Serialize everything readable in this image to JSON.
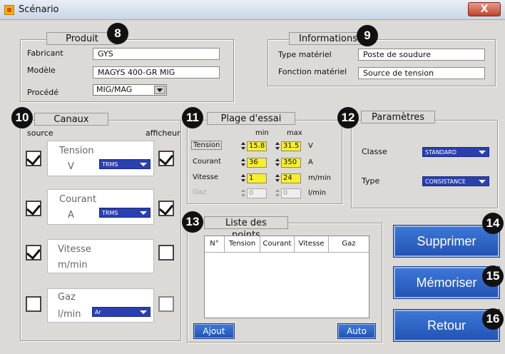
{
  "window": {
    "title": "Scénario",
    "close": "X"
  },
  "produit": {
    "legend": "Produit",
    "fields": [
      {
        "label": "Fabricant",
        "value": "GYS"
      },
      {
        "label": "Modèle",
        "value": "MAGYS 400-GR MIG"
      },
      {
        "label": "Procédé",
        "value": "MIG/MAG"
      }
    ]
  },
  "informations": {
    "legend": "Informations",
    "fields": [
      {
        "label": "Type matériel",
        "value": "Poste de soudure"
      },
      {
        "label": "Fonction matériel",
        "value": "Source de tension"
      }
    ]
  },
  "canaux": {
    "legend": "Canaux",
    "source_label": "source",
    "afficheur_label": "afficheur",
    "channels": [
      {
        "name": "Tension",
        "unit": "V",
        "mode": "TRMS",
        "source": true,
        "afficheur": true,
        "enabled": true
      },
      {
        "name": "Courant",
        "unit": "A",
        "mode": "TRMS",
        "source": true,
        "afficheur": true,
        "enabled": true
      },
      {
        "name": "Vitesse",
        "unit": "m/min",
        "mode": "",
        "source": true,
        "afficheur": false,
        "enabled": true
      },
      {
        "name": "Gaz",
        "unit": "l/min",
        "mode": "Ar",
        "source": false,
        "afficheur": false,
        "enabled": false
      }
    ]
  },
  "plage": {
    "legend": "Plage d'essai",
    "min_label": "min",
    "max_label": "max",
    "rows": [
      {
        "name": "Tension",
        "min": "15.8",
        "max": "31.5",
        "unit": "V",
        "enabled": true
      },
      {
        "name": "Courant",
        "min": "36",
        "max": "350",
        "unit": "A",
        "enabled": true
      },
      {
        "name": "Vitesse",
        "min": "1",
        "max": "24",
        "unit": "m/min",
        "enabled": true
      },
      {
        "name": "Gaz",
        "min": "0",
        "max": "0",
        "unit": "l/min",
        "enabled": false
      }
    ]
  },
  "parametres": {
    "legend": "Paramètres",
    "classe_label": "Classe",
    "classe_value": "STANDARD",
    "type_label": "Type",
    "type_value": "CONSISTANCE"
  },
  "liste": {
    "legend": "Liste des points",
    "columns": [
      "N°",
      "Tension",
      "Courant",
      "Vitesse",
      "Gaz"
    ],
    "ajout": "Ajout",
    "auto": "Auto"
  },
  "buttons": {
    "supprimer": "Supprimer",
    "memoriser": "Mémoriser",
    "retour": "Retour"
  },
  "badges": {
    "b8": "8",
    "b9": "9",
    "b10": "10",
    "b11": "11",
    "b12": "12",
    "b13": "13",
    "b14": "14",
    "b15": "15",
    "b16": "16"
  },
  "colors": {
    "accent": "#2453b4",
    "highlight": "#f7ef2a",
    "combo": "#2a3fb0"
  }
}
